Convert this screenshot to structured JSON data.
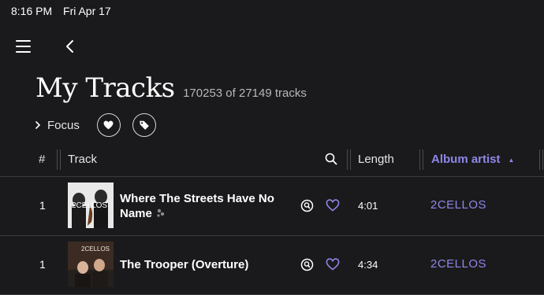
{
  "status": {
    "time": "8:16 PM",
    "date": "Fri Apr 17"
  },
  "header": {
    "title": "My Tracks",
    "count": "170253 of 27149 tracks"
  },
  "filters": {
    "focus_label": "Focus"
  },
  "columns": {
    "num": "#",
    "track": "Track",
    "length": "Length",
    "album_artist": "Album artist"
  },
  "tracks": [
    {
      "num": "1",
      "title": "Where The Streets Have No Name",
      "length": "4:01",
      "artist": "2CELLOS",
      "art_text": "2CELLOS"
    },
    {
      "num": "1",
      "title": "The Trooper (Overture)",
      "length": "4:34",
      "artist": "2CELLOS",
      "art_text": "2CELLOS"
    }
  ],
  "colors": {
    "accent": "#8f86e8",
    "background": "#1a1a1c",
    "divider": "#3a3a3d"
  },
  "icons": [
    "menu-icon",
    "back-chevron-icon",
    "chevron-right-icon",
    "heart-icon",
    "tag-icon",
    "search-icon",
    "track-info-icon",
    "favorite-heart-icon",
    "sort-ascending-icon"
  ]
}
